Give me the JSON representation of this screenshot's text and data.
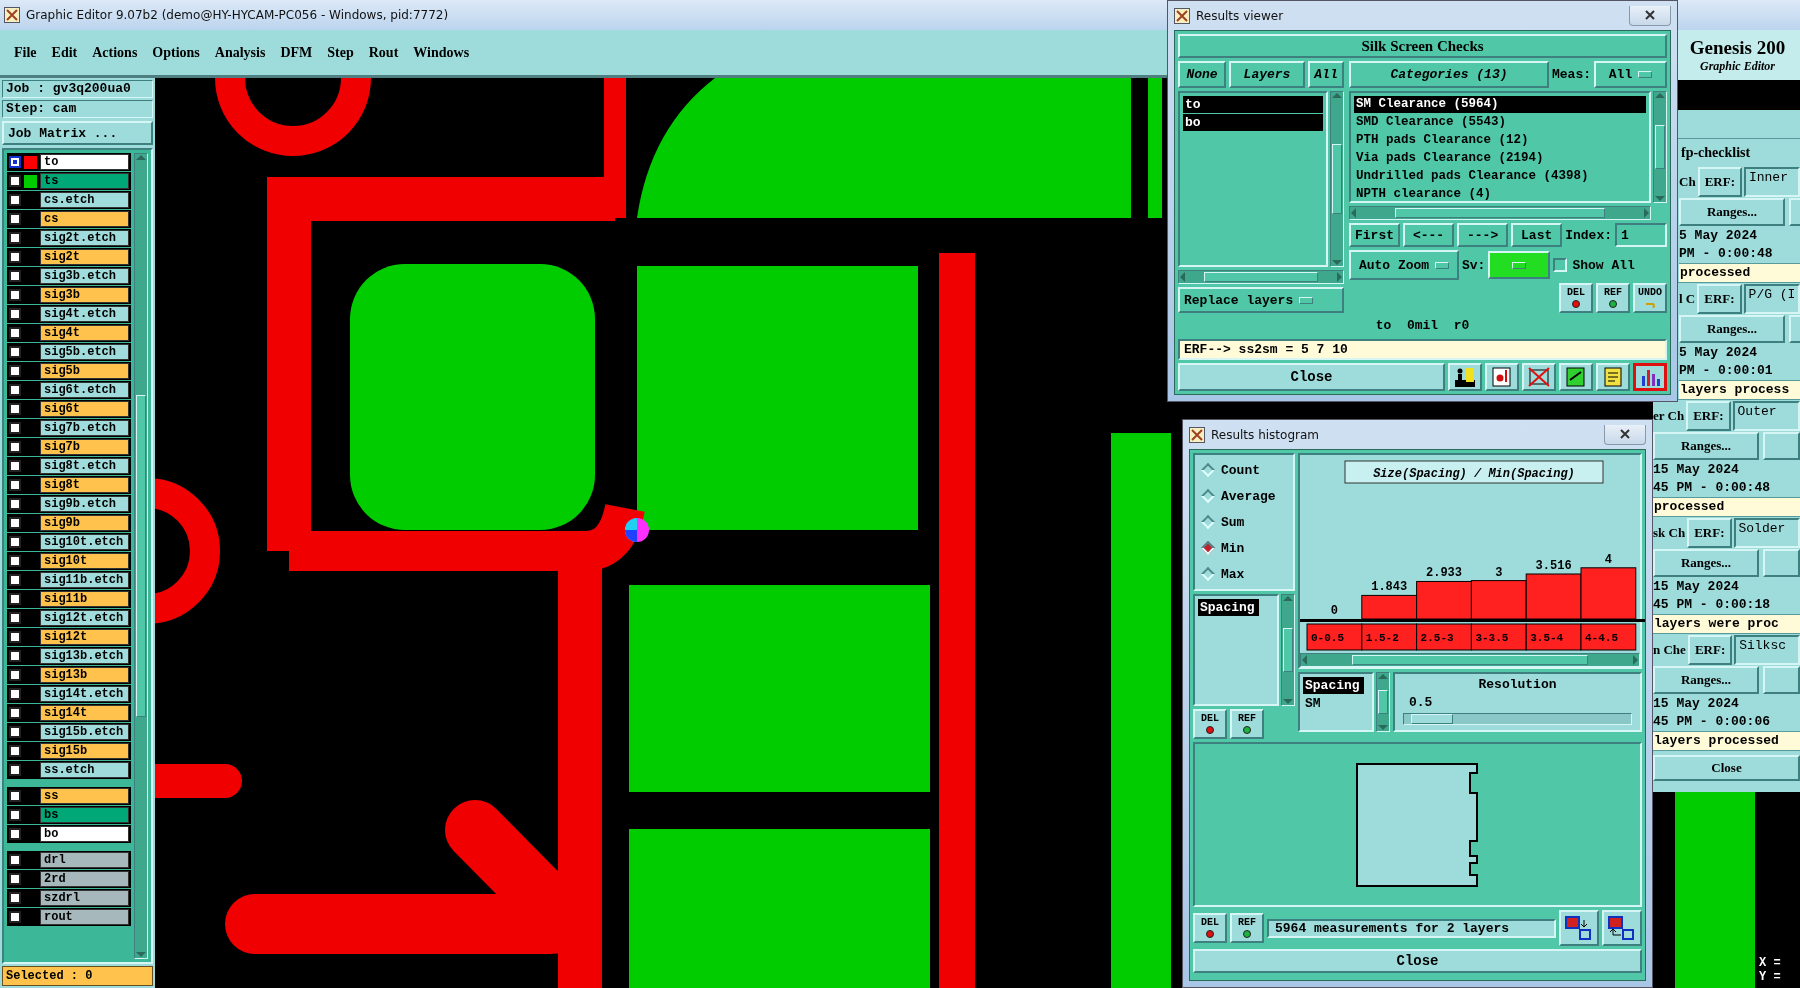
{
  "window": {
    "title": "Graphic Editor 9.07b2 (demo@HY-HYCAM-PC056 - Windows, pid:7772)"
  },
  "menu": [
    "File",
    "Edit",
    "Actions",
    "Options",
    "Analysis",
    "DFM",
    "Step",
    "Rout",
    "Windows"
  ],
  "job": {
    "job": "Job : gv3q200ua0",
    "step": "Step: cam",
    "matrix_button": "Job Matrix ..."
  },
  "layers": [
    [
      {
        "name": "to",
        "color": "#ffffff",
        "display": {
          "color": "#ff0000"
        },
        "selected": true
      },
      {
        "name": "ts",
        "color": "#00a878",
        "display": {
          "color": "#00cc00"
        },
        "selected": false
      },
      {
        "name": "cs.etch",
        "color": "#a0dcdc",
        "selected": false
      },
      {
        "name": "cs",
        "color": "#ffc34d",
        "selected": false
      },
      {
        "name": "sig2t.etch",
        "color": "#a0dcdc",
        "selected": false
      },
      {
        "name": "sig2t",
        "color": "#ffc34d",
        "selected": false
      },
      {
        "name": "sig3b.etch",
        "color": "#a0dcdc",
        "selected": false
      },
      {
        "name": "sig3b",
        "color": "#ffc34d",
        "selected": false
      },
      {
        "name": "sig4t.etch",
        "color": "#a0dcdc",
        "selected": false
      },
      {
        "name": "sig4t",
        "color": "#ffc34d",
        "selected": false
      },
      {
        "name": "sig5b.etch",
        "color": "#a0dcdc",
        "selected": false
      },
      {
        "name": "sig5b",
        "color": "#ffc34d",
        "selected": false
      },
      {
        "name": "sig6t.etch",
        "color": "#a0dcdc",
        "selected": false
      },
      {
        "name": "sig6t",
        "color": "#ffc34d",
        "selected": false
      },
      {
        "name": "sig7b.etch",
        "color": "#a0dcdc",
        "selected": false
      },
      {
        "name": "sig7b",
        "color": "#ffc34d",
        "selected": false
      },
      {
        "name": "sig8t.etch",
        "color": "#a0dcdc",
        "selected": false
      },
      {
        "name": "sig8t",
        "color": "#ffc34d",
        "selected": false
      },
      {
        "name": "sig9b.etch",
        "color": "#a0dcdc",
        "selected": false
      },
      {
        "name": "sig9b",
        "color": "#ffc34d",
        "selected": false
      },
      {
        "name": "sig10t.etch",
        "color": "#a0dcdc",
        "selected": false
      },
      {
        "name": "sig10t",
        "color": "#ffc34d",
        "selected": false
      },
      {
        "name": "sig11b.etch",
        "color": "#a0dcdc",
        "selected": false
      },
      {
        "name": "sig11b",
        "color": "#ffc34d",
        "selected": false
      },
      {
        "name": "sig12t.etch",
        "color": "#a0dcdc",
        "selected": false
      },
      {
        "name": "sig12t",
        "color": "#ffc34d",
        "selected": false
      },
      {
        "name": "sig13b.etch",
        "color": "#a0dcdc",
        "selected": false
      },
      {
        "name": "sig13b",
        "color": "#ffc34d",
        "selected": false
      },
      {
        "name": "sig14t.etch",
        "color": "#a0dcdc",
        "selected": false
      },
      {
        "name": "sig14t",
        "color": "#ffc34d",
        "selected": false
      },
      {
        "name": "sig15b.etch",
        "color": "#a0dcdc",
        "selected": false
      },
      {
        "name": "sig15b",
        "color": "#ffc34d",
        "selected": false
      },
      {
        "name": "ss.etch",
        "color": "#a0dcdc",
        "selected": false
      }
    ],
    [
      {
        "name": "ss",
        "color": "#ffc34d",
        "selected": false
      },
      {
        "name": "bs",
        "color": "#00a878",
        "selected": false
      },
      {
        "name": "bo",
        "color": "#ffffff",
        "selected": false
      }
    ],
    [
      {
        "name": "drl",
        "color": "#a7b8bc",
        "selected": false
      },
      {
        "name": "2rd",
        "color": "#a7b8bc",
        "selected": false
      },
      {
        "name": "szdrl",
        "color": "#a7b8bc",
        "selected": false
      },
      {
        "name": "rout",
        "color": "#a7b8bc",
        "selected": false
      }
    ]
  ],
  "selected_count": "Selected : 0",
  "brand": {
    "name": "Genesis 200",
    "subtitle": "Graphic Editor"
  },
  "coordinates": [
    "X =",
    "Y ="
  ],
  "results_viewer": {
    "title": "Results viewer",
    "heading": "Silk Screen Checks",
    "layer_filter": {
      "none": "None",
      "title": "Layers",
      "all": "All"
    },
    "layers": [
      {
        "name": "to",
        "selected": true
      },
      {
        "name": "bo",
        "selected": true
      }
    ],
    "replace": "Replace layers",
    "categories_button": "Categories (13)",
    "meas_label": "Meas:",
    "meas_value": "All",
    "categories": [
      {
        "label": "SM Clearance (5964)",
        "selected": true
      },
      {
        "label": "SMD Clearance (5543)",
        "selected": false
      },
      {
        "label": "PTH pads Clearance (12)",
        "selected": false
      },
      {
        "label": "Via pads Clearance (2194)",
        "selected": false
      },
      {
        "label": "Undrilled pads Clearance (4398)",
        "selected": false
      },
      {
        "label": "NPTH clearance (4)",
        "selected": false
      }
    ],
    "nav": [
      "First",
      "<---",
      "--->",
      "Last"
    ],
    "index_label": "Index:",
    "index_value": "1",
    "zoom": "Auto Zoom",
    "sv_label": "Sv:",
    "show_all": {
      "label": "Show All",
      "checked": false
    },
    "actions": [
      "DEL",
      "REF",
      "UNDO"
    ],
    "status": "to  0mil  r0",
    "erf": "ERF--> ss2sm = 5 7 10",
    "close": "Close",
    "tools": [
      {
        "kind": "figure",
        "selected": false
      },
      {
        "kind": "record",
        "selected": false
      },
      {
        "kind": "cross",
        "selected": false
      },
      {
        "kind": "split",
        "selected": false
      },
      {
        "kind": "notes",
        "selected": false
      },
      {
        "kind": "chart",
        "selected": true
      }
    ]
  },
  "histogram": {
    "title": "Results histogram",
    "modes": [
      {
        "label": "Count",
        "selected": false
      },
      {
        "label": "Average",
        "selected": false
      },
      {
        "label": "Sum",
        "selected": false
      },
      {
        "label": "Min",
        "selected": true
      },
      {
        "label": "Max",
        "selected": false
      }
    ],
    "attributes": [
      {
        "label": "Spacing",
        "selected": true
      }
    ],
    "actions": [
      "DEL",
      "REF"
    ],
    "chart_data": {
      "type": "bar",
      "title": "Size(Spacing) / Min(Spacing)",
      "categories": [
        "0-0.5",
        "1.5-2",
        "2.5-3",
        "3-3.5",
        "3.5-4",
        "4-4.5"
      ],
      "values": [
        0,
        1.843,
        2.933,
        3,
        3.516,
        4
      ],
      "data_labels": true
    },
    "sort_list": [
      {
        "label": "Spacing",
        "selected": true
      },
      {
        "label": "SM",
        "selected": false
      }
    ],
    "resolution": {
      "label": "Resolution",
      "value": "0.5",
      "level": 0.04
    },
    "footer_actions": [
      "DEL",
      "REF"
    ],
    "summary": "5964 measurements for 2 layers",
    "tools": [
      {
        "kind": "export"
      },
      {
        "kind": "import"
      }
    ],
    "close": "Close"
  },
  "checklist": {
    "title": "fp-checklist",
    "close": "Close",
    "blocks": [
      {
        "label": "Ch",
        "erf": "ERF:",
        "field": "Inner",
        "ranges": "Ranges...",
        "date": "5 May 2024",
        "time": "PM - 0:00:48",
        "status": "processed"
      },
      {
        "label": "l C",
        "erf": "ERF:",
        "field": "P/G (I",
        "ranges": "Ranges...",
        "date": "5 May 2024",
        "time": "PM - 0:00:01",
        "status": "layers process"
      },
      {
        "label": "er Ch",
        "erf": "ERF:",
        "field": "Outer",
        "ranges": "Ranges...",
        "date": "15 May 2024",
        "time": "45 PM - 0:00:48",
        "status": "processed"
      },
      {
        "label": "sk Ch",
        "erf": "ERF:",
        "field": "Solder",
        "ranges": "Ranges...",
        "date": "15 May 2024",
        "time": "45 PM - 0:00:18",
        "status": "layers were proc"
      },
      {
        "label": "n Che",
        "erf": "ERF:",
        "field": "Silksc",
        "ranges": "Ranges...",
        "date": "15 May 2024",
        "time": "45 PM - 0:00:06",
        "status": "layers processed"
      }
    ]
  }
}
